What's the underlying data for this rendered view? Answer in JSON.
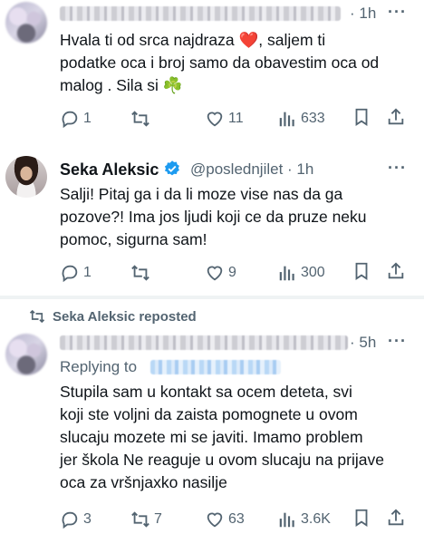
{
  "tweet1": {
    "time": "· 1h",
    "more": "···",
    "text": "Hvala ti od srca najdraza ❤️, saljem ti\npodatke oca i broj samo da obavestim oca od\nmalog . Sila si ☘️",
    "replies": "1",
    "reposts": "",
    "likes": "11",
    "views": "633"
  },
  "tweet2": {
    "name": "Seka Aleksic",
    "handle_time": "@poslednjilet · 1h",
    "more": "···",
    "text": "Salji! Pitaj ga i da li moze vise nas da ga\npozove?! Ima jos ljudi koji ce da pruze neku\npomoc, sigurna sam!",
    "replies": "1",
    "reposts": "",
    "likes": "9",
    "views": "300"
  },
  "tweet3": {
    "repost_label": "Seka Aleksic reposted",
    "time": "· 5h",
    "more": "···",
    "replying_to": "Replying to",
    "text": "Stupila sam u kontakt sa ocem deteta, svi\nkoji ste voljni da zaista pomognete u ovom\nslucaju mozete mi se javiti. Imamo problem\njer škola Ne reaguje u ovom slucaju na prijave\noca za vršnjaxko nasilje",
    "replies": "3",
    "reposts": "7",
    "likes": "63",
    "views": "3.6K"
  },
  "colors": {
    "accent": "#1d9bf0",
    "muted": "#536471",
    "text": "#0f1419"
  },
  "icons": [
    "reply-icon",
    "repost-icon",
    "like-icon",
    "views-icon",
    "bookmark-icon",
    "share-icon",
    "verified-icon",
    "more-icon"
  ]
}
